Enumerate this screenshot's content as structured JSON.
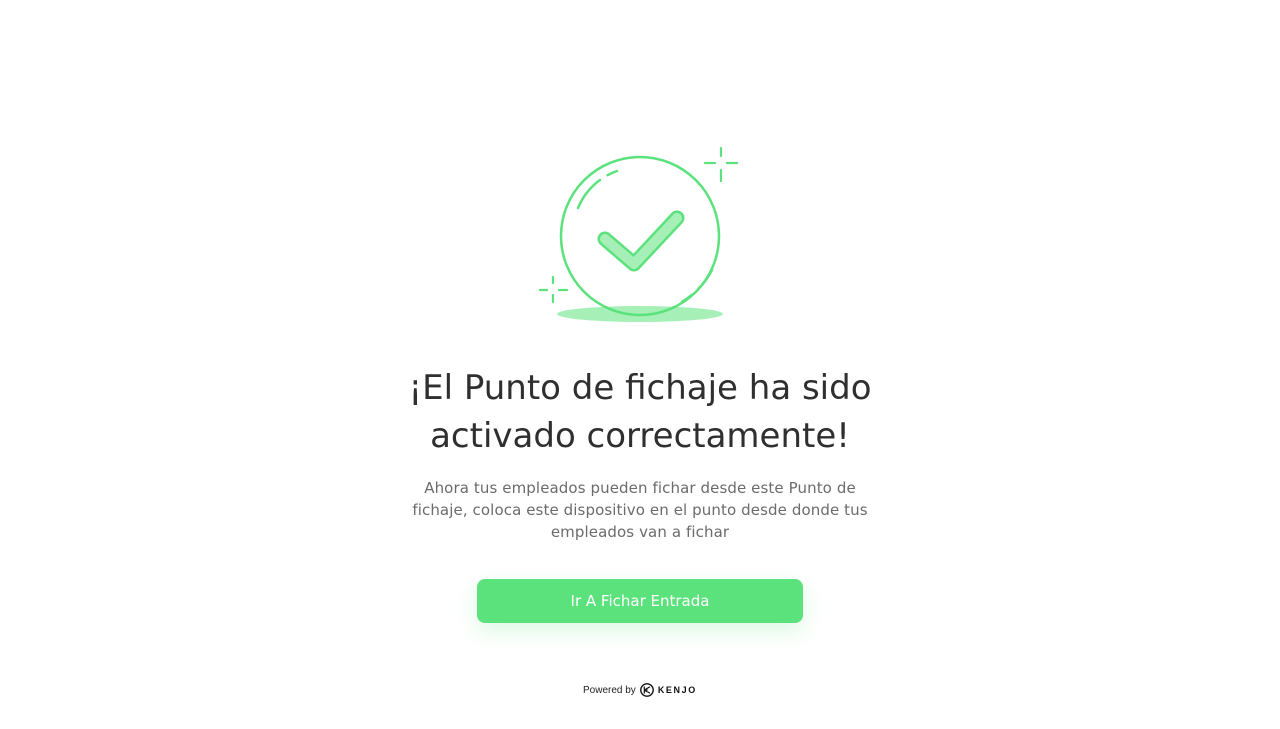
{
  "colors": {
    "accent": "#5be27d",
    "accent_light": "#a6f0b7",
    "title_text": "#2f2f2f",
    "body_text": "#6b6b6b"
  },
  "illustration": {
    "icon": "check-circle-icon"
  },
  "main": {
    "title": "¡El Punto de fichaje ha sido activado correctamente!",
    "description": "Ahora tus empleados pueden fichar desde este Punto de fichaje, coloca este dispositivo en el punto desde donde tus empleados van a fichar",
    "cta_label": "Ir A Fichar Entrada"
  },
  "footer": {
    "powered_by": "Powered by",
    "brand": "KENJO",
    "brand_icon": "kenjo-logo-icon"
  }
}
